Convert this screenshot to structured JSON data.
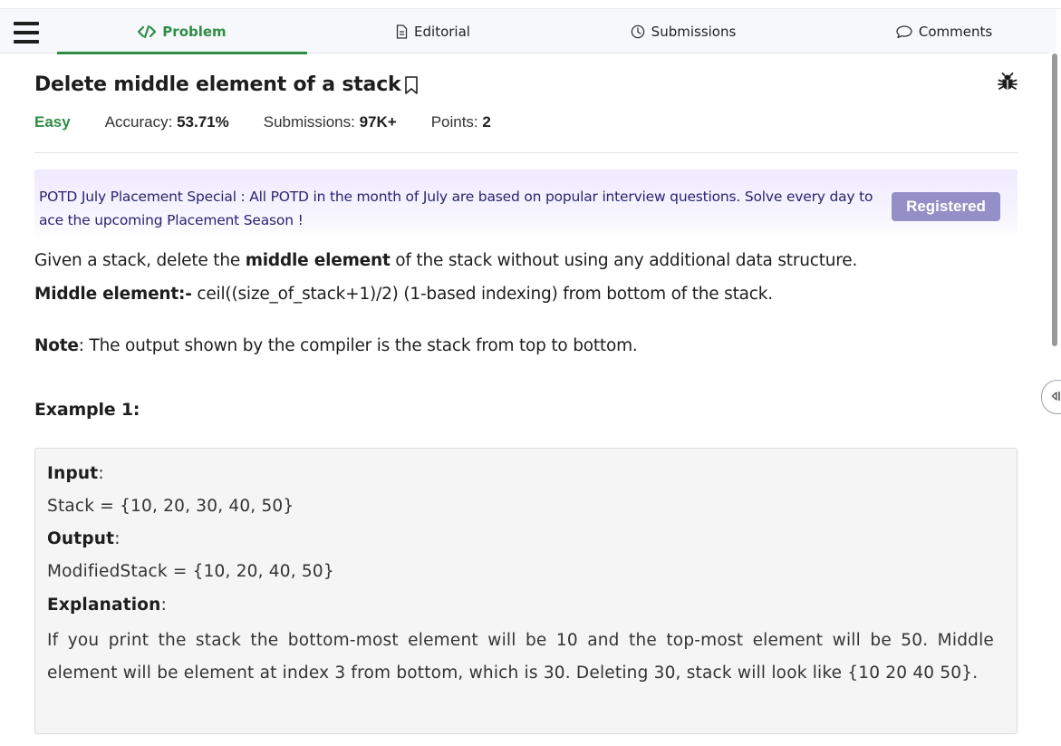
{
  "tabs": {
    "problem": "Problem",
    "editorial": "Editorial",
    "submissions": "Submissions",
    "comments": "Comments"
  },
  "problem": {
    "title": "Delete middle element of a stack",
    "difficulty": "Easy",
    "accuracy_label": "Accuracy: ",
    "accuracy_value": "53.71%",
    "submissions_label": "Submissions: ",
    "submissions_value": "97K+",
    "points_label": "Points: ",
    "points_value": "2"
  },
  "banner": {
    "text": "POTD July Placement Special : All POTD in the month of July are based on popular interview questions. Solve every day to ace the upcoming Placement Season !",
    "button": "Registered"
  },
  "description": {
    "l1_a": "Given a stack, delete the ",
    "l1_b": "middle element",
    "l1_c": " of the stack without using any additional data structure.",
    "l2_a": "Middle element:-",
    "l2_b": " ceil((size_of_stack+1)/2) (1-based indexing) from bottom of the stack.",
    "l3_a": "Note",
    "l3_b": ": The output shown by the compiler is the stack from top to bottom."
  },
  "example": {
    "heading": "Example 1:",
    "input_label": "Input",
    "input_value": "Stack = {10, 20, 30, 40, 50}",
    "output_label": "Output",
    "output_value": "ModifiedStack = {10, 20, 40, 50}",
    "explanation_label": "Explanation",
    "explanation": "If you print the stack the bottom-most element will be 10 and the top-most element will be 50. Middle element will be element at index 3 from bottom, which is 30. Deleting 30, stack will look like {10 20 40 50}.",
    "colon": ":"
  },
  "colors": {
    "accent_green": "#2f8d46",
    "banner_text": "#2b2370",
    "registered_button": "#948fc6"
  }
}
